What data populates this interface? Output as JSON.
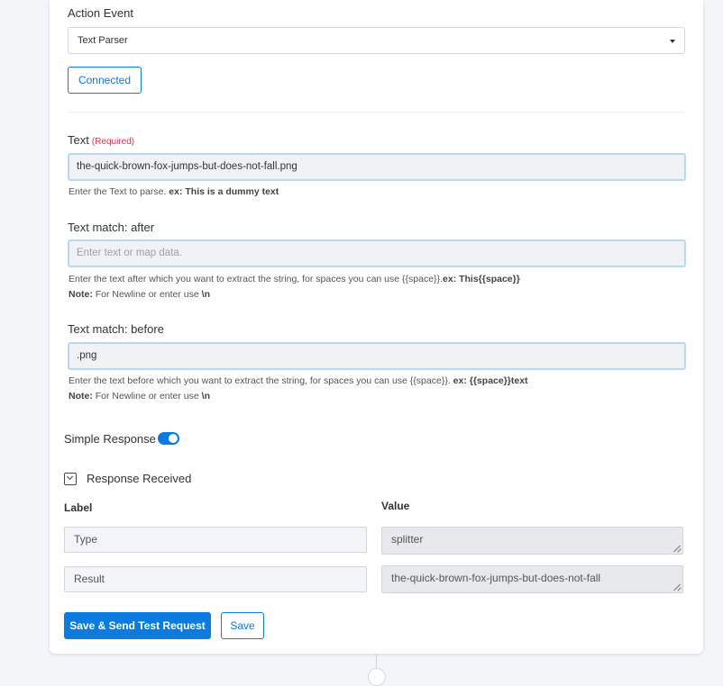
{
  "action_event": {
    "label": "Action Event",
    "selected": "Text Parser"
  },
  "connection": {
    "button_label": "Connected"
  },
  "text_field": {
    "label": "Text",
    "required": "(Required)",
    "value": "the-quick-brown-fox-jumps-but-does-not-fall.png",
    "help_prefix": "Enter the Text to parse.",
    "help_example": "ex: This is a dummy text"
  },
  "after_field": {
    "label": "Text match: after",
    "placeholder": "Enter text or map data.",
    "help_text": "Enter the text after which you want to extract the string, for spaces you can use {{space}}.",
    "help_example": "ex: This{{space}}",
    "note_label": "Note:",
    "note_text": "For Newline or enter use",
    "note_code": "\\n"
  },
  "before_field": {
    "label": "Text match: before",
    "value": ".png",
    "help_text": "Enter the text before which you want to extract the string, for spaces you can use {{space}}.",
    "help_example": "ex: {{space}}text",
    "note_label": "Note:",
    "note_text": "For Newline or enter use",
    "note_code": "\\n"
  },
  "simple_response": {
    "label": "Simple Response",
    "enabled": true
  },
  "response": {
    "title": "Response Received",
    "label_header": "Label",
    "value_header": "Value",
    "rows": [
      {
        "label": "Type",
        "value": "splitter"
      },
      {
        "label": "Result",
        "value": "the-quick-brown-fox-jumps-but-does-not-fall"
      }
    ]
  },
  "actions": {
    "primary_label": "Save & Send Test Request",
    "secondary_label": "Save"
  },
  "colors": {
    "accent": "#0b7be0",
    "required": "#e0304a"
  }
}
